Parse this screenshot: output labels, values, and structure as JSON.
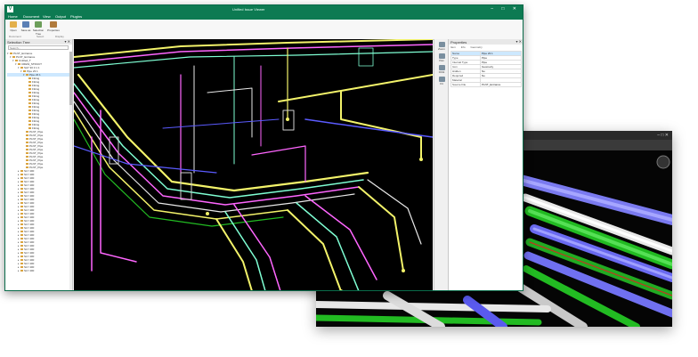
{
  "app": {
    "title": "Unified Issue Viewer",
    "logo": "V",
    "window_controls": "– □ ✕"
  },
  "menu": [
    "Home",
    "Document",
    "View",
    "Output",
    "Plugins"
  ],
  "ribbon": {
    "buttons": [
      {
        "label": "Open",
        "icon": "folder-icon",
        "color": "#e3b04b"
      },
      {
        "label": "Save as",
        "icon": "save-icon",
        "color": "#5a7fb5"
      },
      {
        "label": "Selection Tree",
        "icon": "tree-icon",
        "color": "#6c9e5a"
      },
      {
        "label": "Properties",
        "icon": "properties-icon",
        "color": "#b07a3c"
      }
    ],
    "groups": [
      "Document",
      "Select",
      "Display"
    ]
  },
  "selection_tree": {
    "title": "Selection Tree",
    "controls": "▾ ✕",
    "search_placeholder": "Search...",
    "rows": [
      {
        "indent": 0,
        "twisty": "▾",
        "label": "PLNT_Entrance",
        "selected": false
      },
      {
        "indent": 1,
        "twisty": "▾",
        "label": "PLNT_Entrance",
        "selected": false
      },
      {
        "indent": 2,
        "twisty": "▾",
        "label": "Untitled_T",
        "selected": false
      },
      {
        "indent": 3,
        "twisty": "▾",
        "label": "CREW_STRUCT",
        "selected": false
      },
      {
        "indent": 4,
        "twisty": "▾",
        "label": "SAY 30 0 1 1",
        "selected": false
      },
      {
        "indent": 5,
        "twisty": "▾",
        "label": "Pipe 23 1",
        "selected": false
      },
      {
        "indent": 6,
        "twisty": "▾",
        "label": "Pipe 23 1",
        "selected": true
      },
      {
        "indent": 7,
        "twisty": "",
        "label": "Fitting",
        "selected": false
      },
      {
        "indent": 7,
        "twisty": "",
        "label": "Fitting",
        "selected": false
      },
      {
        "indent": 7,
        "twisty": "",
        "label": "Fitting",
        "selected": false
      },
      {
        "indent": 7,
        "twisty": "",
        "label": "Fitting",
        "selected": false
      },
      {
        "indent": 7,
        "twisty": "",
        "label": "Fitting",
        "selected": false
      },
      {
        "indent": 7,
        "twisty": "",
        "label": "Fitting",
        "selected": false
      },
      {
        "indent": 7,
        "twisty": "",
        "label": "Fitting",
        "selected": false
      },
      {
        "indent": 7,
        "twisty": "",
        "label": "Fitting",
        "selected": false
      },
      {
        "indent": 7,
        "twisty": "",
        "label": "Fitting",
        "selected": false
      },
      {
        "indent": 7,
        "twisty": "",
        "label": "Fitting",
        "selected": false
      },
      {
        "indent": 7,
        "twisty": "",
        "label": "Fitting",
        "selected": false
      },
      {
        "indent": 7,
        "twisty": "",
        "label": "Fitting",
        "selected": false
      },
      {
        "indent": 7,
        "twisty": "",
        "label": "Fitting",
        "selected": false
      },
      {
        "indent": 7,
        "twisty": "",
        "label": "Fitting",
        "selected": false
      },
      {
        "indent": 7,
        "twisty": "",
        "label": "Fitting",
        "selected": false
      },
      {
        "indent": 6,
        "twisty": "",
        "label": "PLNT_Pipe",
        "selected": false
      },
      {
        "indent": 6,
        "twisty": "",
        "label": "PLNT_Pipe",
        "selected": false
      },
      {
        "indent": 6,
        "twisty": "",
        "label": "PLNT_Pipe",
        "selected": false
      },
      {
        "indent": 6,
        "twisty": "",
        "label": "PLNT_Pipe",
        "selected": false
      },
      {
        "indent": 6,
        "twisty": "",
        "label": "PLNT_Pipe",
        "selected": false
      },
      {
        "indent": 6,
        "twisty": "",
        "label": "PLNT_Pipe",
        "selected": false
      },
      {
        "indent": 6,
        "twisty": "",
        "label": "PLNT_Pipe",
        "selected": false
      },
      {
        "indent": 6,
        "twisty": "",
        "label": "PLNT_Pipe",
        "selected": false
      },
      {
        "indent": 6,
        "twisty": "",
        "label": "PLNT_Pipe",
        "selected": false
      },
      {
        "indent": 6,
        "twisty": "",
        "label": "PLNT_Pipe",
        "selected": false
      },
      {
        "indent": 6,
        "twisty": "",
        "label": "PLNT_Pipe",
        "selected": false
      },
      {
        "indent": 4,
        "twisty": "▸",
        "label": "SLY 400",
        "selected": false
      },
      {
        "indent": 4,
        "twisty": "▸",
        "label": "SLY 400",
        "selected": false
      },
      {
        "indent": 4,
        "twisty": "▸",
        "label": "SLY 400",
        "selected": false
      },
      {
        "indent": 4,
        "twisty": "▸",
        "label": "SLY 400",
        "selected": false
      },
      {
        "indent": 4,
        "twisty": "▸",
        "label": "SLY 400",
        "selected": false
      },
      {
        "indent": 4,
        "twisty": "▸",
        "label": "SLY 400",
        "selected": false
      },
      {
        "indent": 4,
        "twisty": "▸",
        "label": "SLY 400",
        "selected": false
      },
      {
        "indent": 4,
        "twisty": "▸",
        "label": "SLY 400",
        "selected": false
      },
      {
        "indent": 4,
        "twisty": "▸",
        "label": "SLY 400",
        "selected": false
      },
      {
        "indent": 4,
        "twisty": "▸",
        "label": "SLY 400",
        "selected": false
      },
      {
        "indent": 4,
        "twisty": "▸",
        "label": "SLY 400",
        "selected": false
      },
      {
        "indent": 4,
        "twisty": "▸",
        "label": "SLY 400",
        "selected": false
      },
      {
        "indent": 4,
        "twisty": "▸",
        "label": "SLY 400",
        "selected": false
      },
      {
        "indent": 4,
        "twisty": "▸",
        "label": "SLY 400",
        "selected": false
      },
      {
        "indent": 4,
        "twisty": "▸",
        "label": "SLY 400",
        "selected": false
      },
      {
        "indent": 4,
        "twisty": "▸",
        "label": "SLY 400",
        "selected": false
      },
      {
        "indent": 4,
        "twisty": "▸",
        "label": "SLY 400",
        "selected": false
      },
      {
        "indent": 4,
        "twisty": "▸",
        "label": "SLY 400",
        "selected": false
      },
      {
        "indent": 4,
        "twisty": "▸",
        "label": "SLY 400",
        "selected": false
      },
      {
        "indent": 4,
        "twisty": "▸",
        "label": "SLY 400",
        "selected": false
      },
      {
        "indent": 4,
        "twisty": "▸",
        "label": "SLY 400",
        "selected": false
      },
      {
        "indent": 4,
        "twisty": "▸",
        "label": "SLY 400",
        "selected": false
      },
      {
        "indent": 4,
        "twisty": "▸",
        "label": "SLY 400",
        "selected": false
      },
      {
        "indent": 4,
        "twisty": "▸",
        "label": "SLY 400",
        "selected": false
      },
      {
        "indent": 4,
        "twisty": "▸",
        "label": "SLY 400",
        "selected": false
      },
      {
        "indent": 4,
        "twisty": "▸",
        "label": "SLY 400",
        "selected": false
      },
      {
        "indent": 4,
        "twisty": "▸",
        "label": "SLY 400",
        "selected": false
      },
      {
        "indent": 4,
        "twisty": "▸",
        "label": "SLY 400",
        "selected": false
      },
      {
        "indent": 4,
        "twisty": "▸",
        "label": "SLY 400",
        "selected": false
      }
    ]
  },
  "viewport_tools": [
    {
      "label": "Zoom",
      "icon": "zoom-icon"
    },
    {
      "label": "Pan",
      "icon": "pan-icon"
    },
    {
      "label": "Orbit",
      "icon": "orbit-icon"
    },
    {
      "label": "Fit",
      "icon": "fit-icon"
    }
  ],
  "properties": {
    "title": "Properties",
    "controls": "▾ ✕",
    "tabs": [
      "Item",
      "Info",
      "Geometry"
    ],
    "rows": [
      {
        "key": "Name",
        "value": "Pipe 23 1",
        "selected": true
      },
      {
        "key": "Type",
        "value": "Pipe",
        "selected": false
      },
      {
        "key": "Internal Type",
        "value": "Pipe",
        "selected": false
      },
      {
        "key": "Icon",
        "value": "Geometry",
        "selected": false
      },
      {
        "key": "Hidden",
        "value": "No",
        "selected": false
      },
      {
        "key": "Required",
        "value": "No",
        "selected": false
      },
      {
        "key": "Material",
        "value": "",
        "selected": false
      },
      {
        "key": "Source File",
        "value": "PLNT_Entrance",
        "selected": false
      }
    ]
  },
  "colors": {
    "accent": "#0d7a52",
    "viewport_bg": "#000000",
    "pipe_yellow": "#f3f36a",
    "pipe_magenta": "#ff66ff",
    "pipe_cyan": "#7fffd4",
    "pipe_blue": "#5b5bff",
    "pipe_white": "#e8e8e8",
    "pipe_green": "#22bb22"
  }
}
